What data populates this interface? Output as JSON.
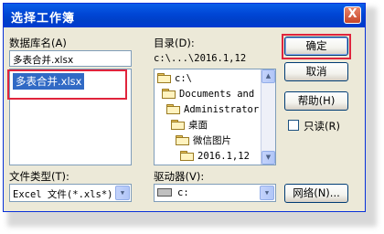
{
  "window": {
    "title": "选择工作簿",
    "close_label": "X"
  },
  "filename": {
    "label": "数据库名(A)",
    "value": "多表合并.xlsx",
    "list_items": [
      "多表合并.xlsx"
    ]
  },
  "directory": {
    "label": "目录(D):",
    "path": "c:\\...\\2016.1,12",
    "tree": [
      "c:\\",
      "Documents and S",
      "Administrator",
      "桌面",
      "微信图片",
      "2016.1,12"
    ]
  },
  "filetype": {
    "label": "文件类型(T):",
    "value": "Excel 文件(*.xls*)"
  },
  "drives": {
    "label": "驱动器(V):",
    "value": "c:"
  },
  "buttons": {
    "ok": "确定",
    "cancel": "取消",
    "help": "帮助(H)",
    "network": "网络(N)..."
  },
  "readonly": {
    "label": "只读(R)",
    "checked": false
  },
  "colors": {
    "title_bar": "#0046d5",
    "highlight": "#316ac5",
    "annotation": "#e0243c",
    "dialog_bg": "#ece9d8"
  }
}
